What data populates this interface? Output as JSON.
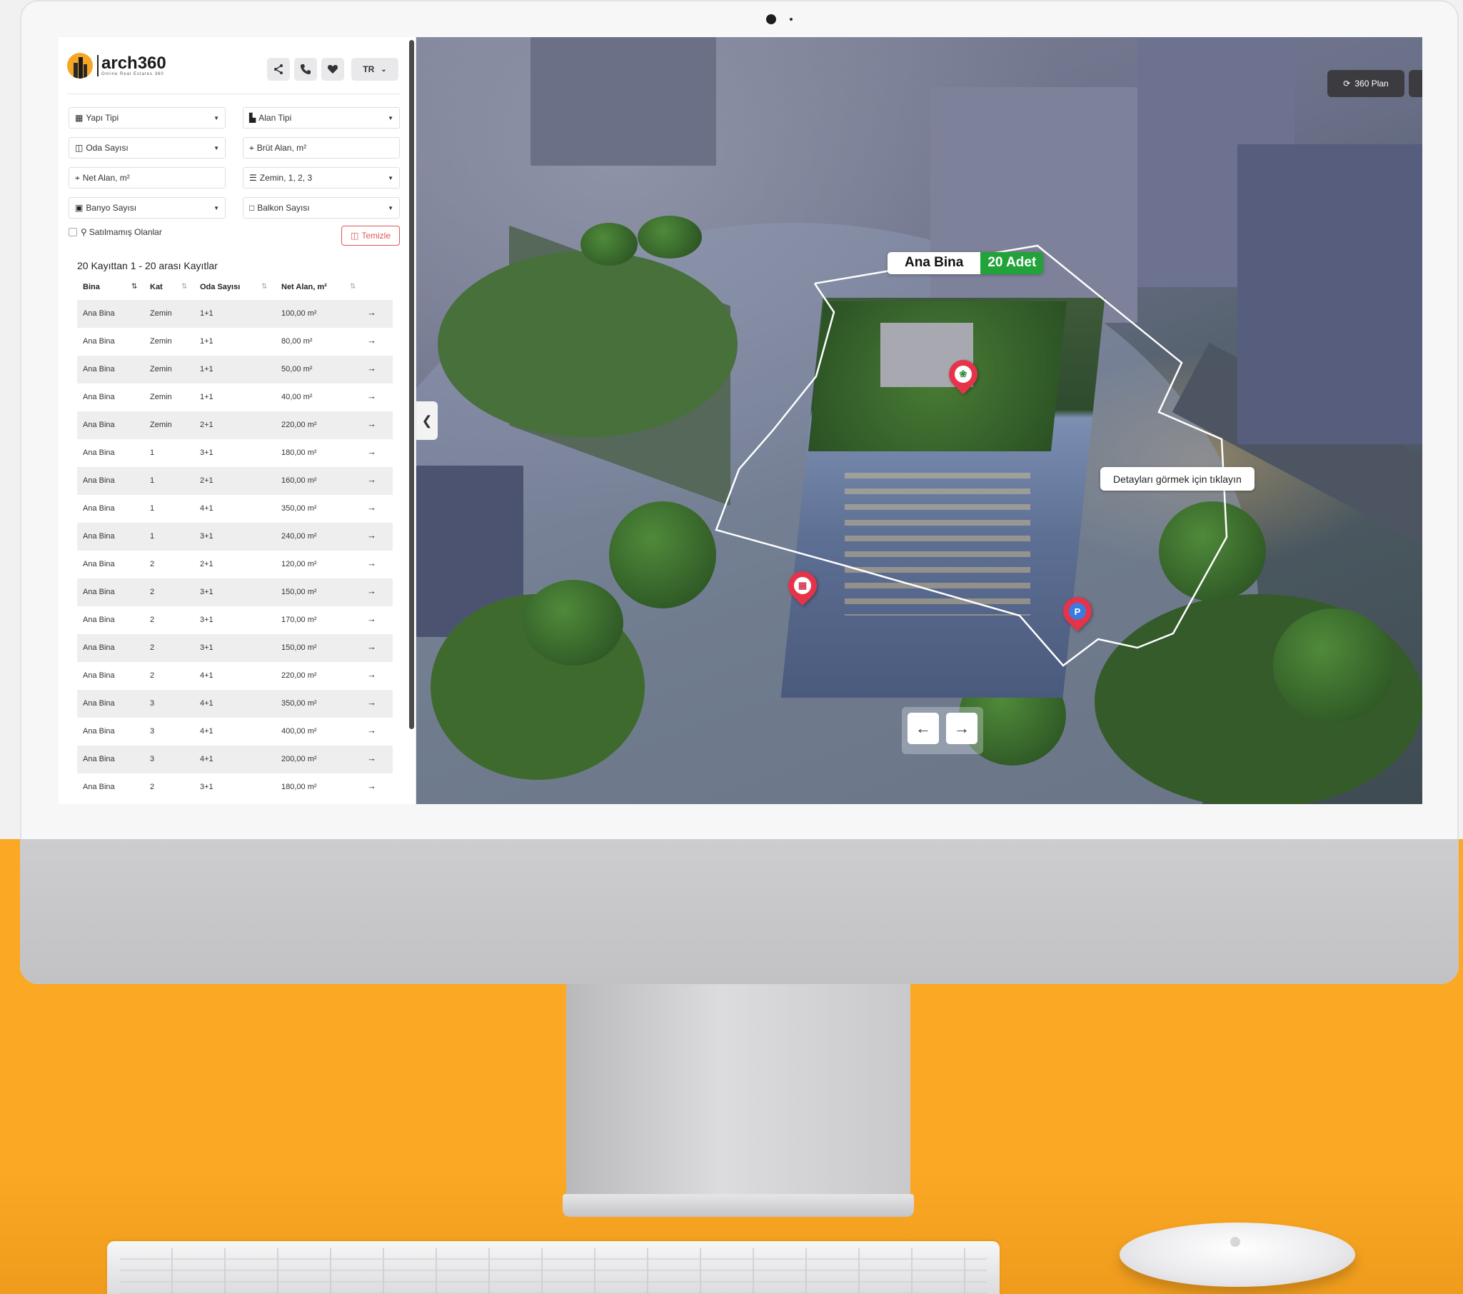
{
  "app": {
    "logo_title": "arch360",
    "logo_subtitle": "Online Real Estates 360",
    "language": "TR"
  },
  "header_icons": [
    "share-icon",
    "phone-icon",
    "heart-icon"
  ],
  "filters": {
    "yapi_tipi": "Yapı Tipi",
    "alan_tipi": "Alan Tipi",
    "oda_sayisi": "Oda Sayısı",
    "brut_alan": "Brüt Alan, m²",
    "net_alan": "Net Alan, m²",
    "kat": "Zemin, 1, 2, 3",
    "banyo_sayisi": "Banyo Sayısı",
    "balkon_sayisi": "Balkon Sayısı",
    "unsold_only": "Satılmamış Olanlar",
    "clear": "Temizle"
  },
  "results": {
    "summary": "20 Kayıttan 1 - 20 arası Kayıtlar",
    "columns": [
      "Bina",
      "Kat",
      "Oda Sayısı",
      "Net Alan, m²"
    ],
    "rows": [
      [
        "Ana Bina",
        "Zemin",
        "1+1",
        "100,00 m²"
      ],
      [
        "Ana Bina",
        "Zemin",
        "1+1",
        "80,00 m²"
      ],
      [
        "Ana Bina",
        "Zemin",
        "1+1",
        "50,00 m²"
      ],
      [
        "Ana Bina",
        "Zemin",
        "1+1",
        "40,00 m²"
      ],
      [
        "Ana Bina",
        "Zemin",
        "2+1",
        "220,00 m²"
      ],
      [
        "Ana Bina",
        "1",
        "3+1",
        "180,00 m²"
      ],
      [
        "Ana Bina",
        "1",
        "2+1",
        "160,00 m²"
      ],
      [
        "Ana Bina",
        "1",
        "4+1",
        "350,00 m²"
      ],
      [
        "Ana Bina",
        "1",
        "3+1",
        "240,00 m²"
      ],
      [
        "Ana Bina",
        "2",
        "2+1",
        "120,00 m²"
      ],
      [
        "Ana Bina",
        "2",
        "3+1",
        "150,00 m²"
      ],
      [
        "Ana Bina",
        "2",
        "3+1",
        "170,00 m²"
      ],
      [
        "Ana Bina",
        "2",
        "3+1",
        "150,00 m²"
      ],
      [
        "Ana Bina",
        "2",
        "4+1",
        "220,00 m²"
      ],
      [
        "Ana Bina",
        "3",
        "4+1",
        "350,00 m²"
      ],
      [
        "Ana Bina",
        "3",
        "4+1",
        "400,00 m²"
      ],
      [
        "Ana Bina",
        "3",
        "4+1",
        "200,00 m²"
      ],
      [
        "Ana Bina",
        "2",
        "3+1",
        "180,00 m²"
      ]
    ]
  },
  "view": {
    "building_name": "Ana Bina",
    "building_count": "20 Adet",
    "tooltip": "Detayları görmek için tıklayın",
    "plan_button": "360 Plan",
    "pins": [
      "plant-pin-icon",
      "shop-pin-icon",
      "parking-pin-icon"
    ],
    "parking_letter": "P"
  },
  "colors": {
    "accent_orange": "#fba824",
    "count_green": "#22a33a",
    "clear_red": "#e05555"
  }
}
